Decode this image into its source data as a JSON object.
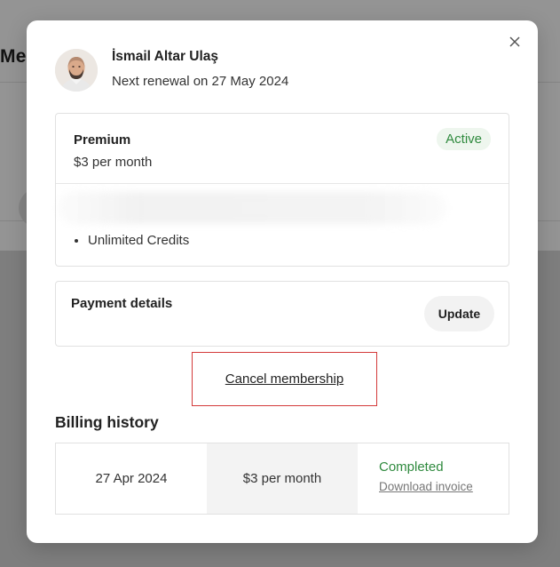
{
  "background": {
    "title_fragment": "Mer"
  },
  "modal": {
    "close_glyph": "✕",
    "user": {
      "name": "İsmail Altar Ulaş",
      "renewal": "Next renewal on 27 May 2024"
    },
    "plan": {
      "name": "Premium",
      "price": "$3 per month",
      "status": "Active",
      "features": [
        "Unlimited Credits"
      ]
    },
    "payment": {
      "title": "Payment details",
      "update_label": "Update"
    },
    "cancel_label": "Cancel membership",
    "billing": {
      "title": "Billing history",
      "rows": [
        {
          "date": "27 Apr 2024",
          "amount": "$3 per month",
          "status": "Completed",
          "download_label": "Download invoice"
        }
      ]
    }
  },
  "colors": {
    "status_green": "#2f8a3e",
    "highlight_red": "#d43a3a",
    "icons": [
      "close-icon",
      "avatar"
    ]
  }
}
